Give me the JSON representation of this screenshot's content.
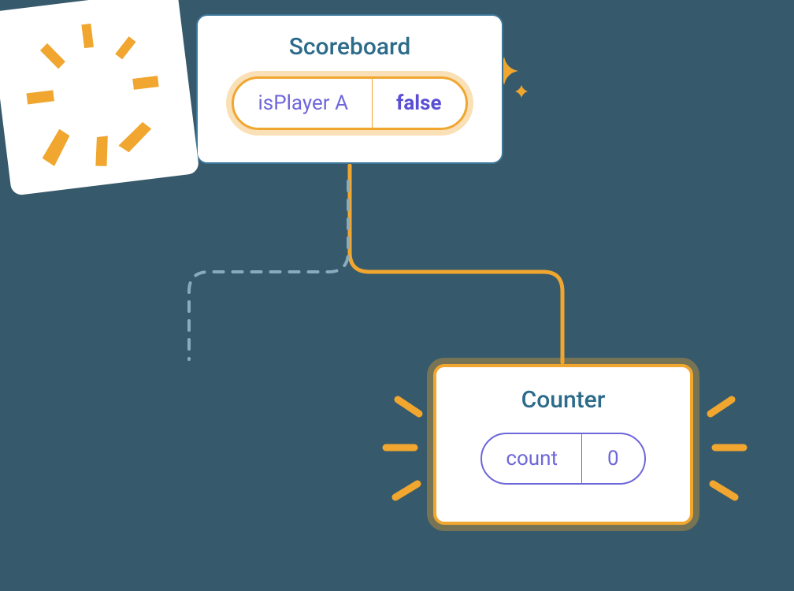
{
  "scoreboard": {
    "title": "Scoreboard",
    "prop_name": "isPlayer A",
    "prop_value": "false"
  },
  "counter": {
    "title": "Counter",
    "state_name": "count",
    "state_value": "0"
  },
  "colors": {
    "accent": "#f0a62f",
    "purple": "#6e67d9",
    "teal": "#2d6b8a",
    "blue_border": "#3c7798",
    "connector_dash": "#8aabbb"
  }
}
